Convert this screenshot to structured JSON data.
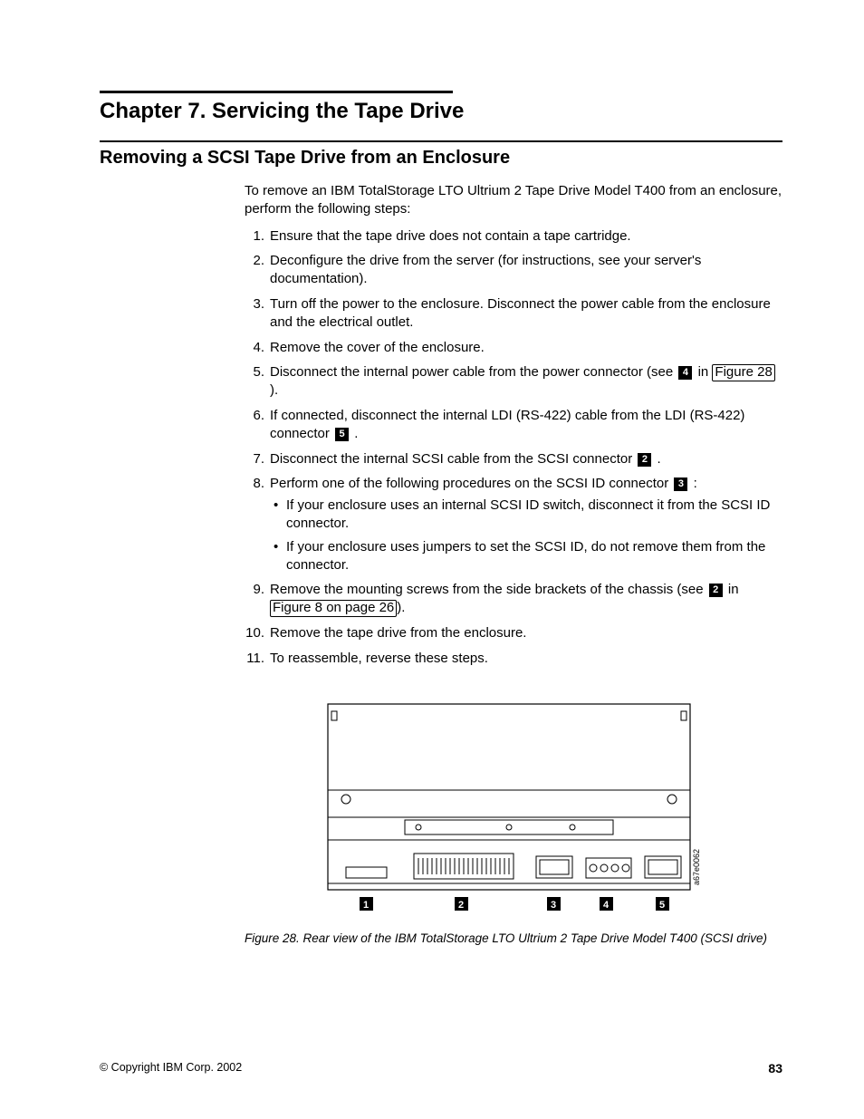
{
  "chapter_title": "Chapter 7. Servicing the Tape Drive",
  "section_title": "Removing a SCSI Tape Drive from an Enclosure",
  "intro": "To remove an IBM TotalStorage LTO Ultrium 2 Tape Drive Model T400 from an enclosure, perform the following steps:",
  "steps": {
    "s1": "Ensure that the tape drive does not contain a tape cartridge.",
    "s2": "Deconfigure the drive from the server (for instructions, see your server's documentation).",
    "s3": "Turn off the power to the enclosure. Disconnect the power cable from the enclosure and the electrical outlet.",
    "s4": "Remove the cover of the enclosure.",
    "s5a": "Disconnect the internal power cable from the power connector (see ",
    "s5b": " in ",
    "s5_link": "Figure 28",
    "s5c": ").",
    "s6a": "If connected, disconnect the internal LDI (RS-422) cable from the LDI (RS-422) connector ",
    "s6b": " .",
    "s7a": "Disconnect the internal SCSI cable from the SCSI connector ",
    "s7b": " .",
    "s8a": "Perform one of the following procedures on the SCSI ID connector ",
    "s8b": " :",
    "s8_sub1": "If your enclosure uses an internal SCSI ID switch, disconnect it from the SCSI ID connector.",
    "s8_sub2": "If your enclosure uses jumpers to set the SCSI ID, do not remove them from the connector.",
    "s9a": "Remove the mounting screws from the side brackets of the chassis (see ",
    "s9b": " in ",
    "s9_link": "Figure 8 on page 26",
    "s9c": ").",
    "s10": "Remove the tape drive from the enclosure.",
    "s11": "To reassemble, reverse these steps."
  },
  "callouts": {
    "n1": "1",
    "n2": "2",
    "n3": "3",
    "n4": "4",
    "n5": "5"
  },
  "figure": {
    "caption": "Figure 28. Rear view of the IBM TotalStorage LTO Ultrium 2 Tape Drive Model T400 (SCSI drive)",
    "side_label": "a67e0062"
  },
  "footer": {
    "copyright": "© Copyright IBM Corp. 2002",
    "page": "83"
  }
}
